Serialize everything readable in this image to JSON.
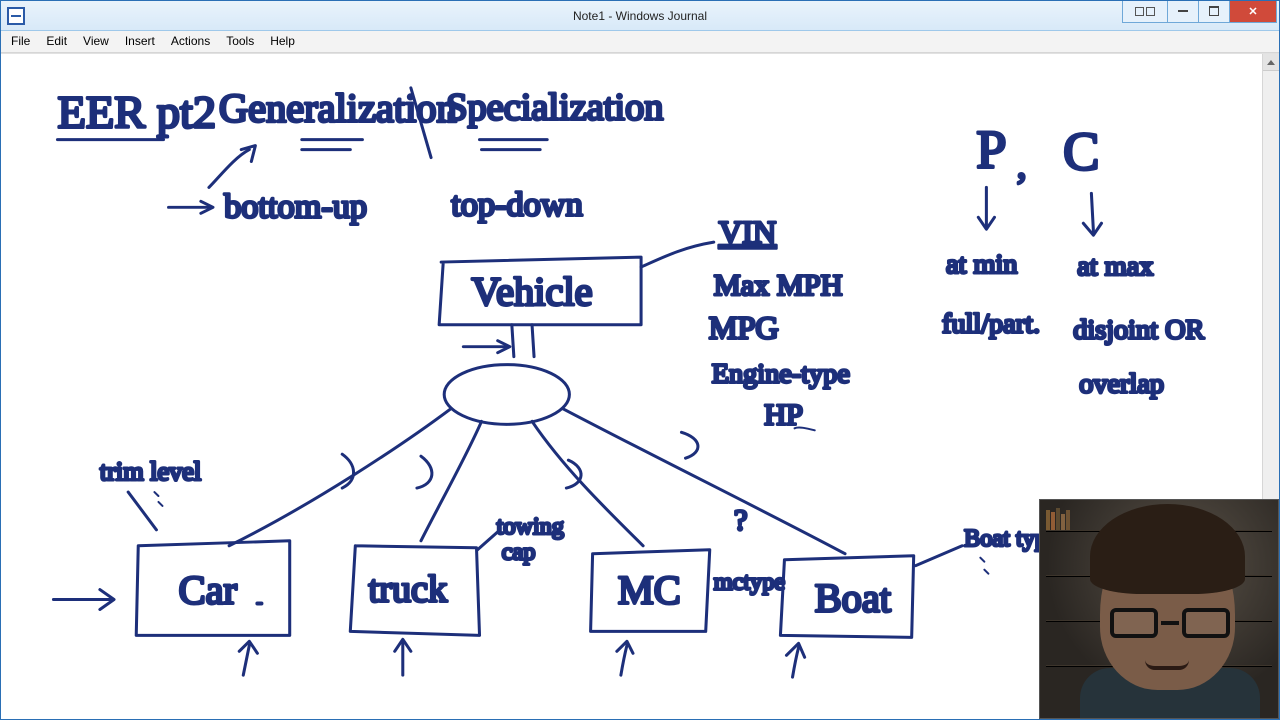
{
  "window": {
    "title": "Note1 - Windows Journal"
  },
  "menu": {
    "file": "File",
    "edit": "Edit",
    "view": "View",
    "insert": "Insert",
    "actions": "Actions",
    "tools": "Tools",
    "help": "Help"
  },
  "ink": {
    "heading_eer": "EER pt2",
    "heading_gen": "Generalization",
    "heading_spec": "Specialization",
    "bottom_up": "bottom-up",
    "top_down": "top-down",
    "vehicle": "Vehicle",
    "vin": "VIN",
    "max_mph": "Max MPH",
    "mpg": "MPG",
    "engine_type": "Engine-type",
    "hp": "HP",
    "trim_level": "trim level",
    "car": "Car",
    "truck": "truck",
    "towing_cap_l1": "towing",
    "towing_cap_l2": "cap",
    "mc": "MC",
    "mctype": "mctype",
    "qmark": "?",
    "boat": "Boat",
    "boat_type": "Boat type",
    "p": "P",
    "c": "C",
    "comma": ",",
    "at_min": "at min",
    "at_max": "at max",
    "full_part": "full/part.",
    "disjoint_or": "disjoint OR",
    "overlap": "overlap"
  },
  "overlay": {
    "webcam_label": "presenter-webcam"
  }
}
